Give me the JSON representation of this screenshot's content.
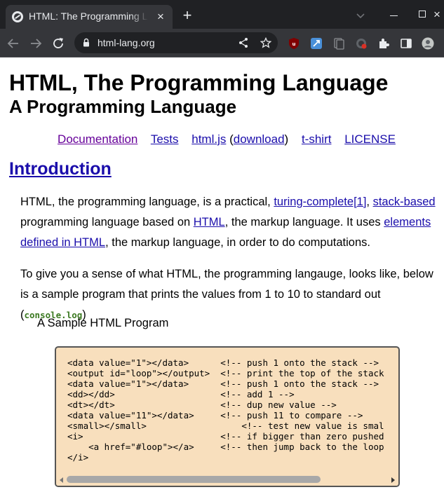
{
  "browser": {
    "tab_title": "HTML: The Programming Language",
    "new_tab_symbol": "+",
    "close_symbol": "×",
    "url": "html-lang.org"
  },
  "page": {
    "title": "HTML, The Programming Language",
    "subtitle": "A Programming Language",
    "nav": {
      "documentation": "Documentation",
      "tests": "Tests",
      "htmljs": "html.js",
      "open_paren": "(",
      "download": "download",
      "close_paren": ")",
      "tshirt": "t-shirt",
      "license": "LICENSE"
    },
    "section_heading": "Introduction",
    "para1": {
      "t1": "HTML, the programming language, is a practical, ",
      "link1": "turing-complete[1]",
      "t2": ", ",
      "link2": "stack-based",
      "t3": " programming language based on ",
      "link3": "HTML",
      "t4": ", the markup language. It uses ",
      "link4": "elements defined in HTML",
      "t5": ", the markup language, in order to do computations."
    },
    "para2": {
      "t1": "To give you a sense of what HTML, the programming langauge, looks like, below is a sample program that prints the values from 1 to 10 to standard out (",
      "code": "console.log",
      "t2": ")"
    },
    "caption": "A Sample HTML Program",
    "code_lines": [
      "<data value=\"1\"></data>      <!-- push 1 onto the stack -->",
      "<output id=\"loop\"></output>  <!-- print the top of the stack",
      "<data value=\"1\"></data>      <!-- push 1 onto the stack -->",
      "<dd></dd>                    <!-- add 1 -->",
      "<dt></dt>                    <!-- dup new value -->",
      "<data value=\"11\"></data>     <!-- push 11 to compare -->",
      "<small></small>                  <!-- test new value is smal",
      "<i>                          <!-- if bigger than zero pushed",
      "    <a href=\"#loop\"></a>     <!-- then jump back to the loop",
      "</i>"
    ]
  }
}
